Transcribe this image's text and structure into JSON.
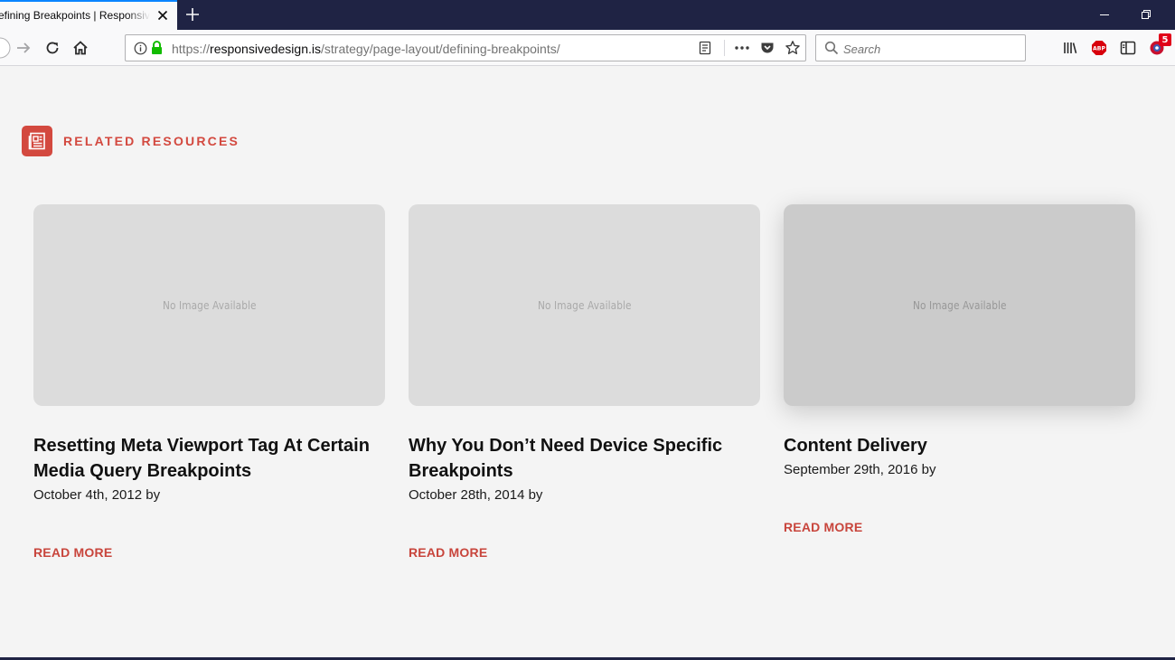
{
  "browser": {
    "tab_title": "efining Breakpoints | Responsive W",
    "url": {
      "prefix": "https://",
      "host": "responsivedesign.is",
      "path": "/strategy/page-layout/defining-breakpoints/"
    },
    "search_placeholder": "Search",
    "extension_badge_count": "5"
  },
  "page": {
    "section_title": "RELATED RESOURCES",
    "cards": [
      {
        "image_text": "No Image Available",
        "title": "Resetting Meta Viewport Tag At Certain Media Query Breakpoints",
        "meta": "October 4th, 2012 by",
        "link": "READ MORE"
      },
      {
        "image_text": "No Image Available",
        "title": "Why You Don’t Need Device Specific Breakpoints",
        "meta": "October 28th, 2014 by",
        "link": "READ MORE"
      },
      {
        "image_text": "No Image Available",
        "title": "Content Delivery",
        "meta": "September 29th, 2016 by",
        "link": "READ MORE"
      }
    ]
  },
  "colors": {
    "accent": "#d3493f",
    "titlebar": "#1f2344",
    "page_background": "#f4f4f4"
  },
  "icons": {
    "back": "back-arrow-icon",
    "forward": "forward-arrow-icon",
    "reload": "reload-icon",
    "home": "home-icon",
    "site_info": "info-icon",
    "secure": "lock-icon",
    "reader": "reader-view-icon",
    "page_actions": "more-dots-icon",
    "pocket": "pocket-icon",
    "bookmark": "star-icon",
    "search": "search-icon",
    "library": "library-icon",
    "adblock": "adblock-icon",
    "sidebar": "sidebar-icon",
    "extension": "extension-icon",
    "section": "news-icon"
  }
}
